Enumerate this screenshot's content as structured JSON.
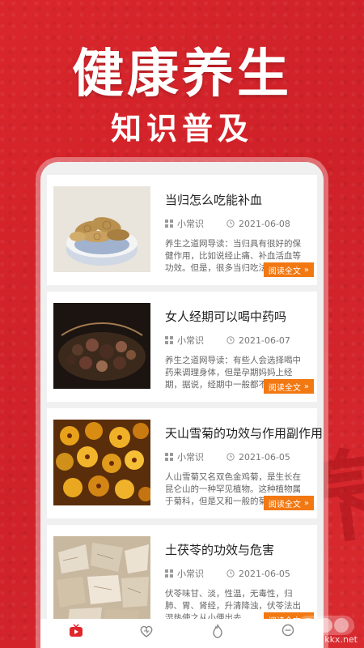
{
  "promo": {
    "headline": "健康养生",
    "subline": "知识普及",
    "bg_char": "养"
  },
  "articles": [
    {
      "title": "当归怎么吃能补血",
      "category": "小常识",
      "date": "2021-06-08",
      "excerpt": "养生之道网导读：当归具有很好的保健作用，比如说经止痛、补血活血等功效。但是，很多当归吃法不当的，",
      "read_label": "阅读全文",
      "thumb": "angelica"
    },
    {
      "title": "女人经期可以喝中药吗",
      "category": "小常识",
      "date": "2021-06-07",
      "excerpt": "养生之道网导读：有些人会选择喝中药来调理身体，但是孕期妈妈上经期，据说，经期中一般都不会建议喝中",
      "read_label": "阅读全文",
      "thumb": "herbs"
    },
    {
      "title": "天山雪菊的功效与作用副作用",
      "category": "小常识",
      "date": "2021-06-05",
      "excerpt": "人山雪菊又名双色金鸡菊，是生长在昆仑山的一种罕见植物。这种植物属于菊科，但是又和一般的菊花",
      "read_label": "阅读全文",
      "thumb": "chrysanthemum"
    },
    {
      "title": "土茯苓的功效与危害",
      "category": "小常识",
      "date": "2021-06-05",
      "excerpt": "伏苓味甘、淡，性温，无毒性，归肺、胃、肾经，升清降浊，伏苓法出湿热使之从小便出去",
      "read_label": "阅读全文",
      "thumb": "poria"
    }
  ],
  "watermark": "www.kkx.net",
  "colors": {
    "background": "#d8262b",
    "button": "#f27812",
    "tab_active": "#e0262c"
  },
  "tabs": [
    "home-icon",
    "heart-icon",
    "flame-icon",
    "chat-icon"
  ]
}
